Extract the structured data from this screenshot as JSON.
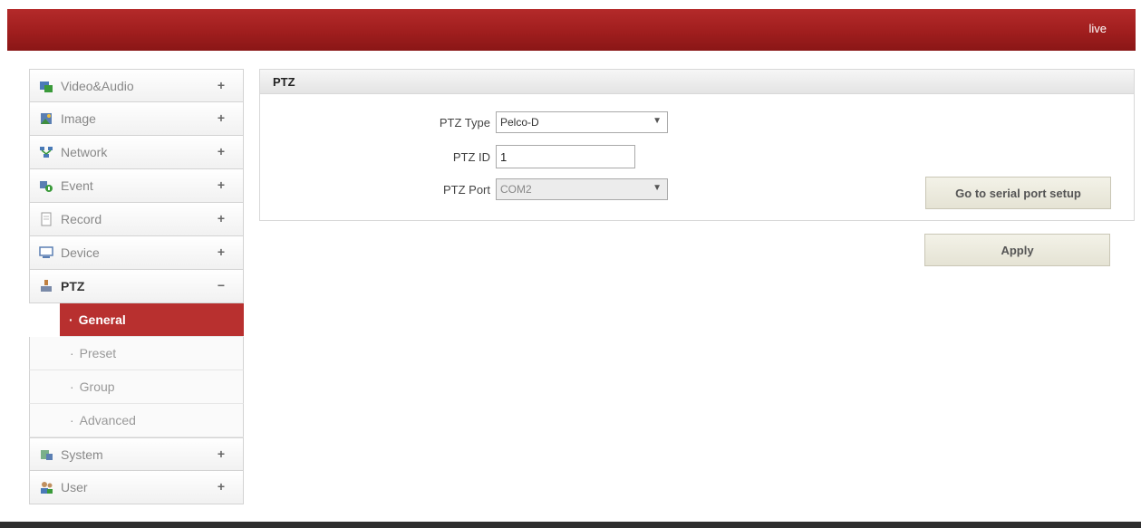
{
  "header": {
    "live_label": "live"
  },
  "sidebar": {
    "items": [
      {
        "label": "Video&Audio",
        "toggle": "+",
        "icon": "video-audio-icon"
      },
      {
        "label": "Image",
        "toggle": "+",
        "icon": "image-icon"
      },
      {
        "label": "Network",
        "toggle": "+",
        "icon": "network-icon"
      },
      {
        "label": "Event",
        "toggle": "+",
        "icon": "event-icon"
      },
      {
        "label": "Record",
        "toggle": "+",
        "icon": "record-icon"
      },
      {
        "label": "Device",
        "toggle": "+",
        "icon": "device-icon"
      },
      {
        "label": "PTZ",
        "toggle": "−",
        "icon": "ptz-icon"
      },
      {
        "label": "System",
        "toggle": "+",
        "icon": "system-icon"
      },
      {
        "label": "User",
        "toggle": "+",
        "icon": "user-icon"
      }
    ],
    "ptz_sub": [
      {
        "label": "General",
        "bullet": "·"
      },
      {
        "label": "Preset",
        "bullet": "·"
      },
      {
        "label": "Group",
        "bullet": "·"
      },
      {
        "label": "Advanced",
        "bullet": "·"
      }
    ]
  },
  "panel": {
    "title": "PTZ",
    "ptz_type": {
      "label": "PTZ Type",
      "value": "Pelco-D"
    },
    "ptz_id": {
      "label": "PTZ ID",
      "value": "1"
    },
    "ptz_port": {
      "label": "PTZ Port",
      "value": "COM2"
    },
    "serial_button": "Go to serial port setup",
    "apply_button": "Apply"
  },
  "colors": {
    "accent": "#b8302f",
    "header_red": "#a01e1e"
  }
}
